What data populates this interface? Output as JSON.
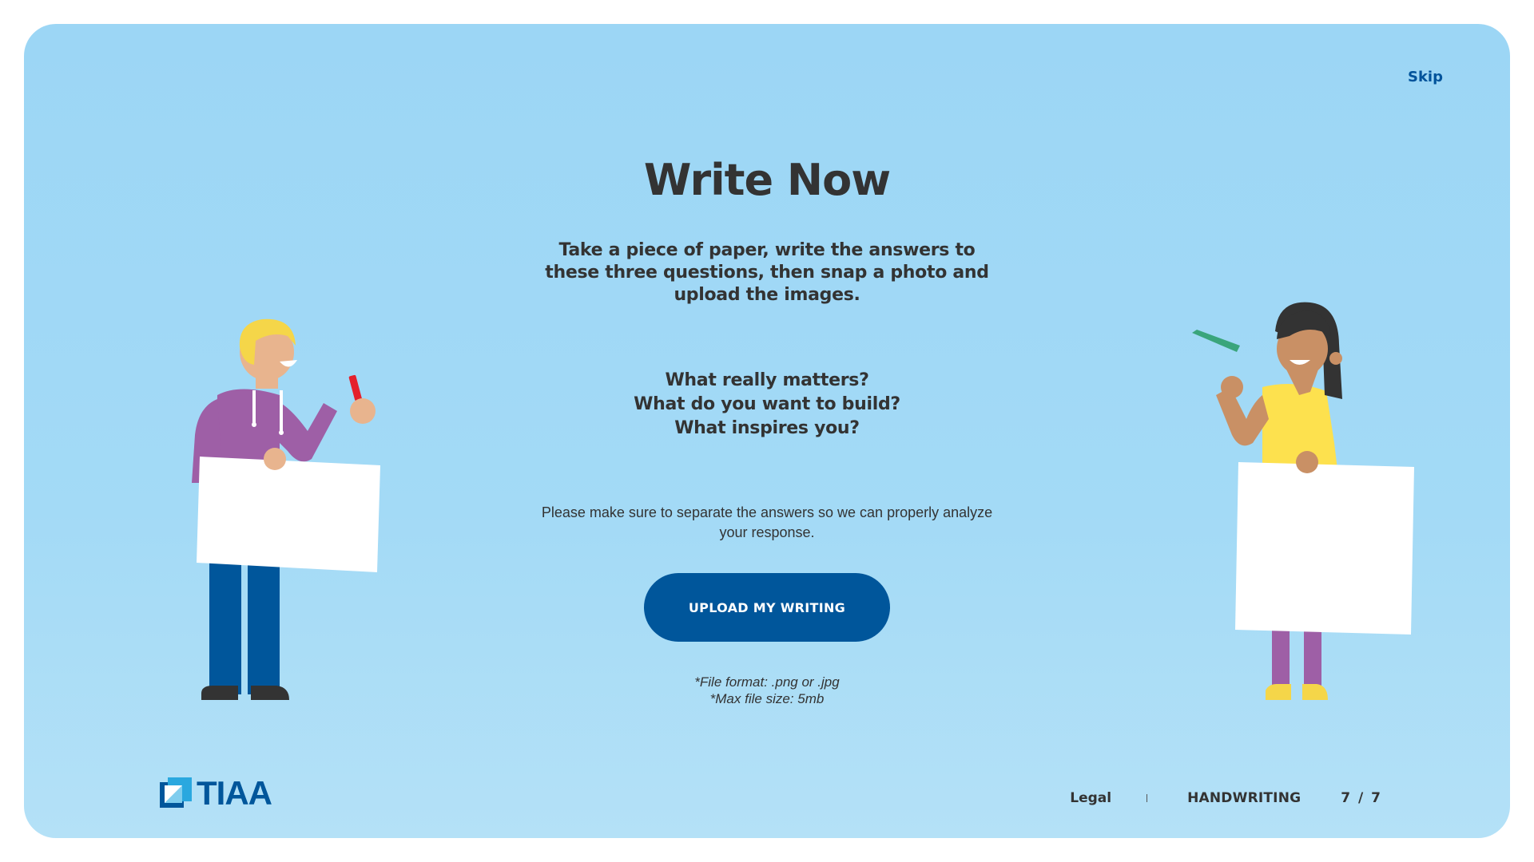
{
  "header": {
    "skip_label": "Skip"
  },
  "main": {
    "title": "Write Now",
    "intro": "Take a piece of paper, write the answers to these three questions, then snap a photo and upload the images.",
    "questions": [
      "What really matters?",
      "What do you want to build?",
      "What inspires you?"
    ],
    "note": "Please make sure to separate the answers so we can properly analyze your response.",
    "upload_label": "UPLOAD MY WRITING",
    "file_format": "*File format: .png or .jpg",
    "max_size": "*Max file size: 5mb"
  },
  "footer": {
    "logo_text": "TIAA",
    "legal_label": "Legal",
    "section_label": "HANDWRITING",
    "pager": "7 / 7"
  },
  "colors": {
    "background": "#9cd6f5",
    "brand_blue": "#00569b",
    "text": "#333333",
    "button_text": "#ffffff"
  },
  "icons": [
    "tiaa-logo-icon",
    "person-with-sign-left",
    "person-with-sign-right"
  ]
}
